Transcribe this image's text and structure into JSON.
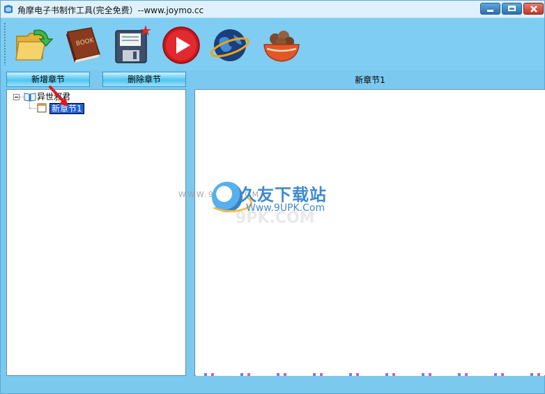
{
  "window": {
    "title": "角摩电子书制作工具(完全免费）--www.joymo.cc"
  },
  "toolbar": {
    "items": [
      {
        "name": "open-folder-icon"
      },
      {
        "name": "book-icon"
      },
      {
        "name": "save-disk-icon"
      },
      {
        "name": "play-icon"
      },
      {
        "name": "globe-icon"
      },
      {
        "name": "basket-icon"
      }
    ]
  },
  "actions": {
    "add_chapter": "新增章节",
    "delete_chapter": "删除章节"
  },
  "tree": {
    "root_label": "异世邪君",
    "child_label": "新章节1"
  },
  "editor": {
    "header": "新章节1"
  },
  "watermark": {
    "brand": "久友下载站",
    "url": "Www.9UPK.Com",
    "faint": "WWW.9UPK.COM"
  },
  "colors": {
    "window_bg": "#7cc9f0",
    "selection": "#1e5fd6",
    "close_button": "#c4382a"
  }
}
